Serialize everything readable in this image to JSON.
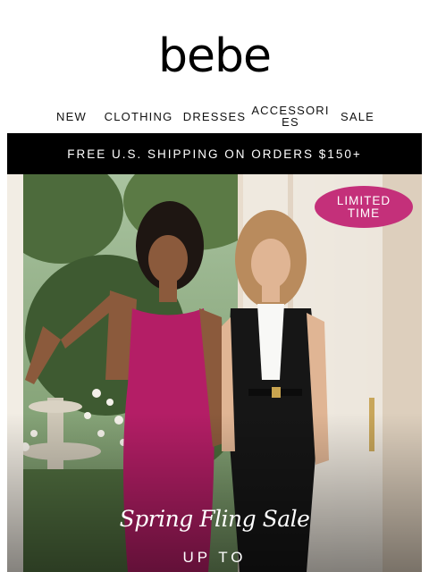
{
  "brand": {
    "logo_text": "bebe"
  },
  "nav": {
    "items": [
      {
        "label": "NEW"
      },
      {
        "label": "CLOTHING"
      },
      {
        "label": "DRESSES"
      },
      {
        "label": "ACCESSORIES"
      },
      {
        "label": "SALE"
      }
    ]
  },
  "banner": {
    "text": "FREE U.S. SHIPPING ON ORDERS $150+"
  },
  "hero": {
    "badge_line1": "LIMITED",
    "badge_line2": "TIME",
    "headline": "Spring Fling Sale",
    "subline": "UP TO"
  },
  "colors": {
    "badge": "#c4307a",
    "banner_bg": "#000000",
    "dress": "#b41e66"
  }
}
